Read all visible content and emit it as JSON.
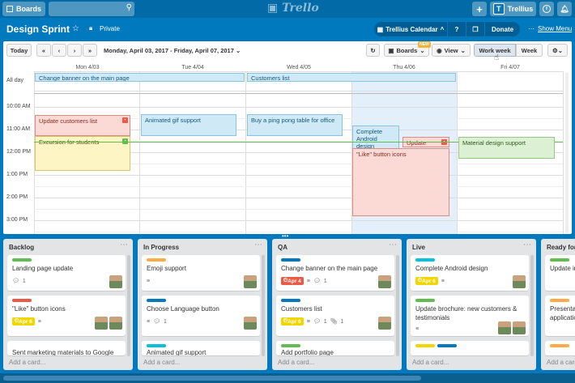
{
  "topbar": {
    "boards_label": "Boards",
    "logo_text": "Trello",
    "user_label": "Trellius",
    "search_placeholder": ""
  },
  "header": {
    "board_title": "Design Sprint",
    "visibility": "Private",
    "calendar_label": "Trellius Calendar",
    "donate_label": "Donate",
    "show_menu": "Show Menu"
  },
  "calendar": {
    "today_label": "Today",
    "prev_prev": "«",
    "prev": "‹",
    "next": "›",
    "next_next": "»",
    "range": "Monday, April 03, 2017 - Friday, April 07, 2017",
    "boards_label": "Boards",
    "boards_badge": "NEW",
    "view_label": "View",
    "work_week_label": "Work week",
    "week_label": "Week",
    "days": [
      "Mon 4/03",
      "Tue 4/04",
      "Wed 4/05",
      "Thu 4/06",
      "Fri 4/07"
    ],
    "all_day": "All day",
    "times": [
      "10:00 AM",
      "11:00 AM",
      "12:00 PM",
      "1:00 PM",
      "2:00 PM",
      "3:00 PM"
    ],
    "events": {
      "change_banner": "Change banner on the main page",
      "customers_list": "Customers list",
      "update_customers": "Update customers list",
      "animated_gif": "Animated gif support",
      "ping_pong": "Buy a ping pong table for office",
      "complete_android": "Complete Android design",
      "update": "Update",
      "material": "Material design support",
      "excursion": "Excursion for students",
      "like_button": "\"Like\" button icons"
    }
  },
  "lists": [
    {
      "name": "Backlog",
      "cards": [
        {
          "title": "Landing page update",
          "comments": "1"
        },
        {
          "title": "\"Like\" button icons",
          "due": "Apr 6"
        },
        {
          "title": "Sent marketing materials to Google"
        }
      ],
      "add": "Add a card..."
    },
    {
      "name": "In Progress",
      "cards": [
        {
          "title": "Emoji support"
        },
        {
          "title": "Choose Language button",
          "comments": "1"
        },
        {
          "title": "Animated gif support"
        }
      ],
      "add": "Add a card..."
    },
    {
      "name": "QA",
      "cards": [
        {
          "title": "Change banner on the main page",
          "due": "Apr 4",
          "comments": "1"
        },
        {
          "title": "Customers list",
          "due": "Apr 6",
          "comments": "1",
          "attachments": "1"
        },
        {
          "title": "Add portfolio page"
        }
      ],
      "add": "Add a card..."
    },
    {
      "name": "Live",
      "cards": [
        {
          "title": "Complete Android design",
          "due": "Apr 6"
        },
        {
          "title": "Update brochure: new customers & testimonials"
        },
        {
          "title": ""
        }
      ],
      "add": "Add a card..."
    },
    {
      "name": "Ready for",
      "cards": [
        {
          "title": "Update in"
        },
        {
          "title": "Presentat application"
        },
        {
          "title": ""
        }
      ],
      "add": "Add a card..."
    }
  ],
  "colors": {
    "board": "#0079bf",
    "green": "#61bd4f",
    "yellow": "#f2d600",
    "orange": "#ffab4a",
    "red": "#eb5a46",
    "blue": "#0079bf",
    "sky": "#00c2e0"
  }
}
